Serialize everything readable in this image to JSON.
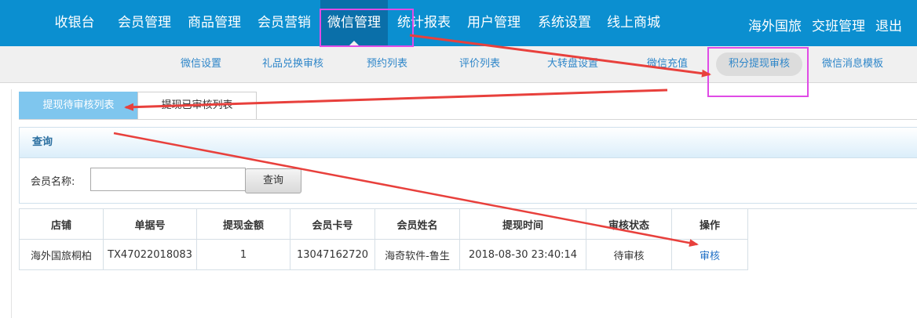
{
  "topnav": {
    "items": [
      "收银台",
      "会员管理",
      "商品管理",
      "会员营销",
      "微信管理",
      "统计报表",
      "用户管理",
      "系统设置",
      "线上商城"
    ],
    "active": "微信管理",
    "right": [
      "海外国旅",
      "交班管理",
      "退出"
    ]
  },
  "subnav": {
    "items": [
      "微信设置",
      "礼品兑换审核",
      "预约列表",
      "评价列表",
      "大转盘设置",
      "微信充值",
      "积分提现审核",
      "微信消息模板"
    ],
    "active": "积分提现审核"
  },
  "tabs": [
    "提现待审核列表",
    "提现已审核列表"
  ],
  "query": {
    "title": "查询",
    "member_name_label": "会员名称:",
    "member_name_value": "",
    "search_button": "查询"
  },
  "table": {
    "headers": [
      "店铺",
      "单据号",
      "提现金额",
      "会员卡号",
      "会员姓名",
      "提现时间",
      "审核状态",
      "操作"
    ],
    "rows": [
      [
        "海外国旅桐柏",
        "TX47022018083",
        "1",
        "13047162720",
        "海奇软件-鲁生",
        "2018-08-30 23:40:14",
        "待审核",
        "审核"
      ]
    ]
  },
  "colors": {
    "topnav_bg": "#0b8fd0",
    "topnav_active_bg": "#0a6fa9",
    "tab_active_bg": "#7fc6ee",
    "link": "#2e86c9",
    "highlight": "#e04be6",
    "arrow": "#e8403c"
  }
}
